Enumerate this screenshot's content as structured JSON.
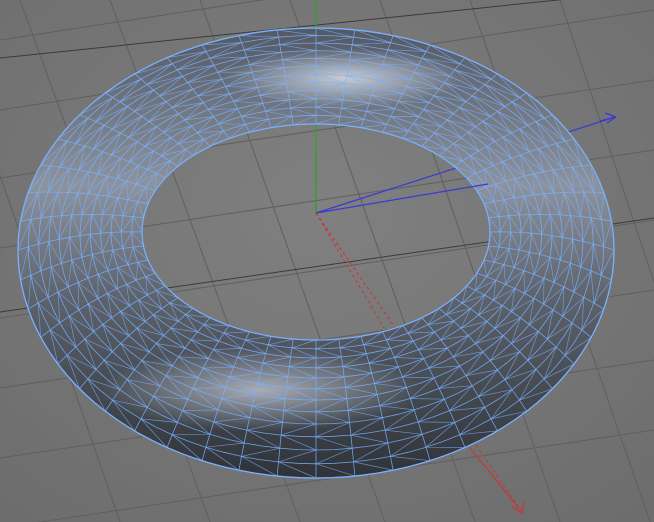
{
  "viewport": {
    "view": "perspective",
    "background_color": "#777777",
    "grid_line_color": "#5f5f5f",
    "grid_floor_line_color": "#3b3b3b"
  },
  "axes": {
    "x_color": "#c33a3a",
    "y_color": "#2fa22f",
    "z_color": "#3a3ad2"
  },
  "object": {
    "type": "torus",
    "mode": "wireframe-on-shaded",
    "wire_color": "#79b1ff",
    "surface_dark": "#4d5158",
    "surface_mid": "#7c8290",
    "surface_light": "#c9cdd5"
  }
}
